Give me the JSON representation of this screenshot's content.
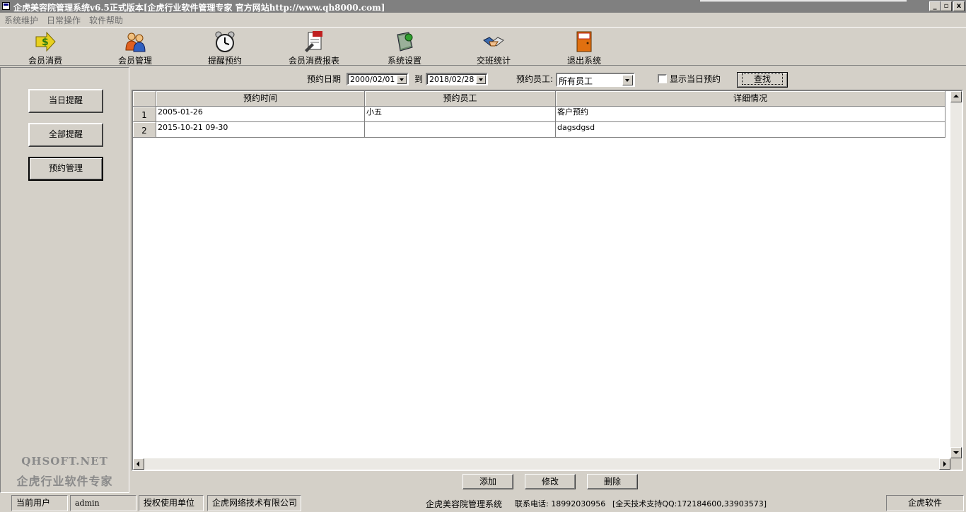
{
  "window": {
    "title": "企虎美容院管理系统v6.5正式版本[企虎行业软件管理专家 官方网站http://www.qh8000.com]",
    "controls": {
      "minimize": "_",
      "restore": "▫",
      "close": "x"
    }
  },
  "menu": [
    "系统维护",
    "日常操作",
    "软件帮助"
  ],
  "toolbar": [
    {
      "label": "会员消费",
      "icon": "dollar-arrow-icon"
    },
    {
      "label": "会员管理",
      "icon": "members-icon"
    },
    {
      "label": "提醒预约",
      "icon": "alarm-clock-icon"
    },
    {
      "label": "会员消费报表",
      "icon": "report-icon"
    },
    {
      "label": "系统设置",
      "icon": "settings-icon"
    },
    {
      "label": "交班统计",
      "icon": "handshake-icon"
    },
    {
      "label": "退出系统",
      "icon": "exit-door-icon"
    }
  ],
  "sidebar": {
    "buttons": [
      "当日提醒",
      "全部提醒",
      "预约管理"
    ],
    "active": "预约管理",
    "brand_en": "QHSOFT.NET",
    "brand_cn": "企虎行业软件专家"
  },
  "filter": {
    "date_label": "预约日期",
    "date_from": "2000/02/01",
    "to_label": "到",
    "date_to": "2018/02/28",
    "staff_label": "预约员工:",
    "staff_value": "所有员工",
    "show_today_label": "显示当日预约",
    "show_today_checked": false,
    "find_label": "查找"
  },
  "table": {
    "columns": [
      "预约时间",
      "预约员工",
      "详细情况"
    ],
    "rows": [
      {
        "num": "1",
        "time": "2005-01-26",
        "staff": "小五",
        "detail": "客户预约"
      },
      {
        "num": "2",
        "time": "2015-10-21 09-30",
        "staff": "",
        "detail": "dagsdgsd"
      }
    ]
  },
  "actions": {
    "add": "添加",
    "edit": "修改",
    "delete": "删除"
  },
  "statusbar": {
    "user_label": "当前用户",
    "user_value": "admin",
    "license_label": "授权使用单位",
    "license_value": "企虎网络技术有限公司",
    "system_name": "企虎美容院管理系统",
    "phone": "联系电话: 18992030956",
    "support": "[全天技术支持QQ:172184600,33903573]",
    "vendor": "企虎软件"
  },
  "colors": {
    "face": "#d4d0c8",
    "title_inactive": "#808080",
    "brand_gray": "#8a8a8a"
  }
}
